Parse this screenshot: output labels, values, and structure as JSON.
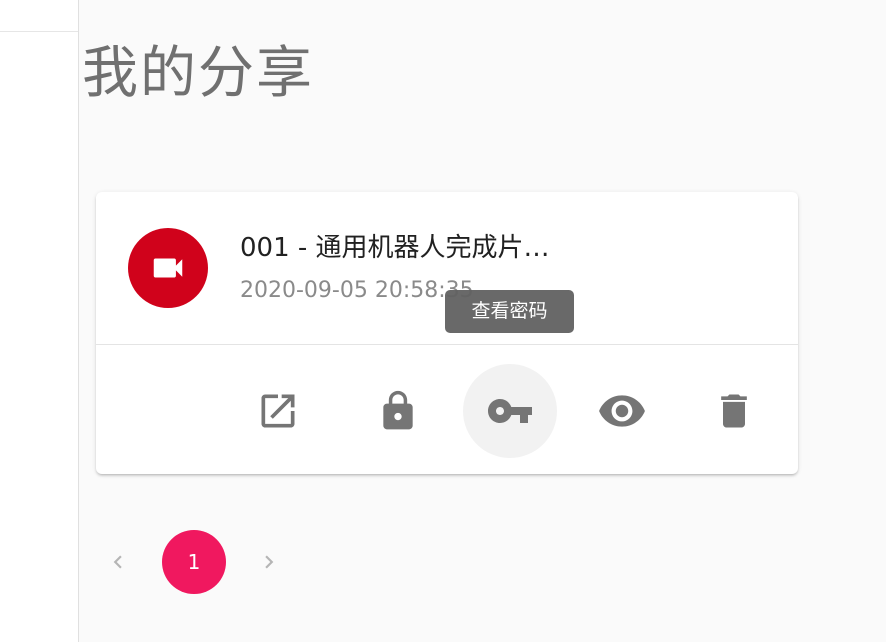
{
  "page": {
    "title": "我的分享"
  },
  "share_item": {
    "name": "001 - 通用机器人完成片…",
    "date": "2020-09-05 20:58:35",
    "file_type_icon": "videocam-icon",
    "avatar_color": "#d0021b"
  },
  "actions": [
    {
      "icon": "open-in-new-icon"
    },
    {
      "icon": "lock-icon"
    },
    {
      "icon": "key-icon"
    },
    {
      "icon": "eye-icon"
    },
    {
      "icon": "delete-icon"
    }
  ],
  "tooltip": {
    "text": "查看密码"
  },
  "pagination": {
    "current_page": "1",
    "accent_color": "#f0185f"
  }
}
